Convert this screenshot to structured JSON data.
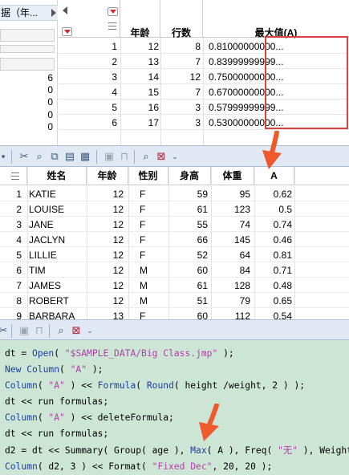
{
  "top_window": {
    "tab_label": "据（年...",
    "left_counts": [
      "6",
      "0",
      "0",
      "0",
      "0"
    ]
  },
  "summary_table": {
    "headers": [
      "年龄",
      "行数",
      "最大值(A)"
    ],
    "rows": [
      {
        "idx": "1",
        "age": "12",
        "count": "8",
        "max": "0.81000000000..."
      },
      {
        "idx": "2",
        "age": "13",
        "count": "7",
        "max": "0.83999999999..."
      },
      {
        "idx": "3",
        "age": "14",
        "count": "12",
        "max": "0.75000000000..."
      },
      {
        "idx": "4",
        "age": "15",
        "count": "7",
        "max": "0.67000000000..."
      },
      {
        "idx": "5",
        "age": "16",
        "count": "3",
        "max": "0.57999999999..."
      },
      {
        "idx": "6",
        "age": "17",
        "count": "3",
        "max": "0.53000000000..."
      }
    ]
  },
  "toolbar": {
    "icons": [
      "save-icon",
      "cut-icon",
      "search-icon",
      "copy-icon",
      "paste-icon",
      "table-icon",
      "formula-icon",
      "lock-icon",
      "find-icon",
      "filter-icon"
    ]
  },
  "data_table": {
    "headers": [
      "姓名",
      "年龄",
      "性别",
      "身高",
      "体重",
      "A"
    ],
    "rows": [
      {
        "i": "1",
        "name": "KATIE",
        "age": "12",
        "sex": "F",
        "height": "59",
        "weight": "95",
        "a": "0.62"
      },
      {
        "i": "2",
        "name": "LOUISE",
        "age": "12",
        "sex": "F",
        "height": "61",
        "weight": "123",
        "a": "0.5"
      },
      {
        "i": "3",
        "name": "JANE",
        "age": "12",
        "sex": "F",
        "height": "55",
        "weight": "74",
        "a": "0.74"
      },
      {
        "i": "4",
        "name": "JACLYN",
        "age": "12",
        "sex": "F",
        "height": "66",
        "weight": "145",
        "a": "0.46"
      },
      {
        "i": "5",
        "name": "LILLIE",
        "age": "12",
        "sex": "F",
        "height": "52",
        "weight": "64",
        "a": "0.81"
      },
      {
        "i": "6",
        "name": "TIM",
        "age": "12",
        "sex": "M",
        "height": "60",
        "weight": "84",
        "a": "0.71"
      },
      {
        "i": "7",
        "name": "JAMES",
        "age": "12",
        "sex": "M",
        "height": "61",
        "weight": "128",
        "a": "0.48"
      },
      {
        "i": "8",
        "name": "ROBERT",
        "age": "12",
        "sex": "M",
        "height": "51",
        "weight": "79",
        "a": "0.65"
      },
      {
        "i": "9",
        "name": "BARBARA",
        "age": "13",
        "sex": "F",
        "height": "60",
        "weight": "112",
        "a": "0.54"
      }
    ]
  },
  "script": {
    "lines": [
      [
        {
          "t": "dt = ",
          "c": ""
        },
        {
          "t": "Open",
          "c": "kw"
        },
        {
          "t": "( ",
          "c": ""
        },
        {
          "t": "\"$SAMPLE_DATA/Big Class.jmp\"",
          "c": "st"
        },
        {
          "t": " );",
          "c": ""
        }
      ],
      [
        {
          "t": "New Column",
          "c": "kw"
        },
        {
          "t": "( ",
          "c": ""
        },
        {
          "t": "\"A\"",
          "c": "st"
        },
        {
          "t": " );",
          "c": ""
        }
      ],
      [
        {
          "t": "Column",
          "c": "kw"
        },
        {
          "t": "( ",
          "c": ""
        },
        {
          "t": "\"A\"",
          "c": "st"
        },
        {
          "t": " ) << ",
          "c": ""
        },
        {
          "t": "Formula",
          "c": "kw"
        },
        {
          "t": "( ",
          "c": ""
        },
        {
          "t": "Round",
          "c": "kw"
        },
        {
          "t": "( height /weight, 2 ) );",
          "c": ""
        }
      ],
      [
        {
          "t": "dt << run formulas;",
          "c": ""
        }
      ],
      [
        {
          "t": "Column",
          "c": "kw"
        },
        {
          "t": "( ",
          "c": ""
        },
        {
          "t": "\"A\"",
          "c": "st"
        },
        {
          "t": " ) << deleteFormula;",
          "c": ""
        }
      ],
      [
        {
          "t": "dt << run formulas;",
          "c": ""
        }
      ],
      [
        {
          "t": "d2 = dt << Summary( Group( age ), ",
          "c": ""
        },
        {
          "t": "Max",
          "c": "kw"
        },
        {
          "t": "( A ), Freq( ",
          "c": ""
        },
        {
          "t": "\"无\"",
          "c": "st"
        },
        {
          "t": " ), Weight",
          "c": ""
        }
      ],
      [
        {
          "t": "Column",
          "c": "kw"
        },
        {
          "t": "( d2, 3 ) << Format( ",
          "c": ""
        },
        {
          "t": "\"Fixed Dec\"",
          "c": "st"
        },
        {
          "t": ", 20, 20 );",
          "c": ""
        }
      ]
    ]
  },
  "colors": {
    "highlight_box": "#d9443a",
    "arrow": "#ee5a2c",
    "editor_bg": "#cde5d5",
    "toolbar_bg": "#dfe8f3",
    "keyword": "#1b3fa3",
    "string": "#b040a8"
  }
}
